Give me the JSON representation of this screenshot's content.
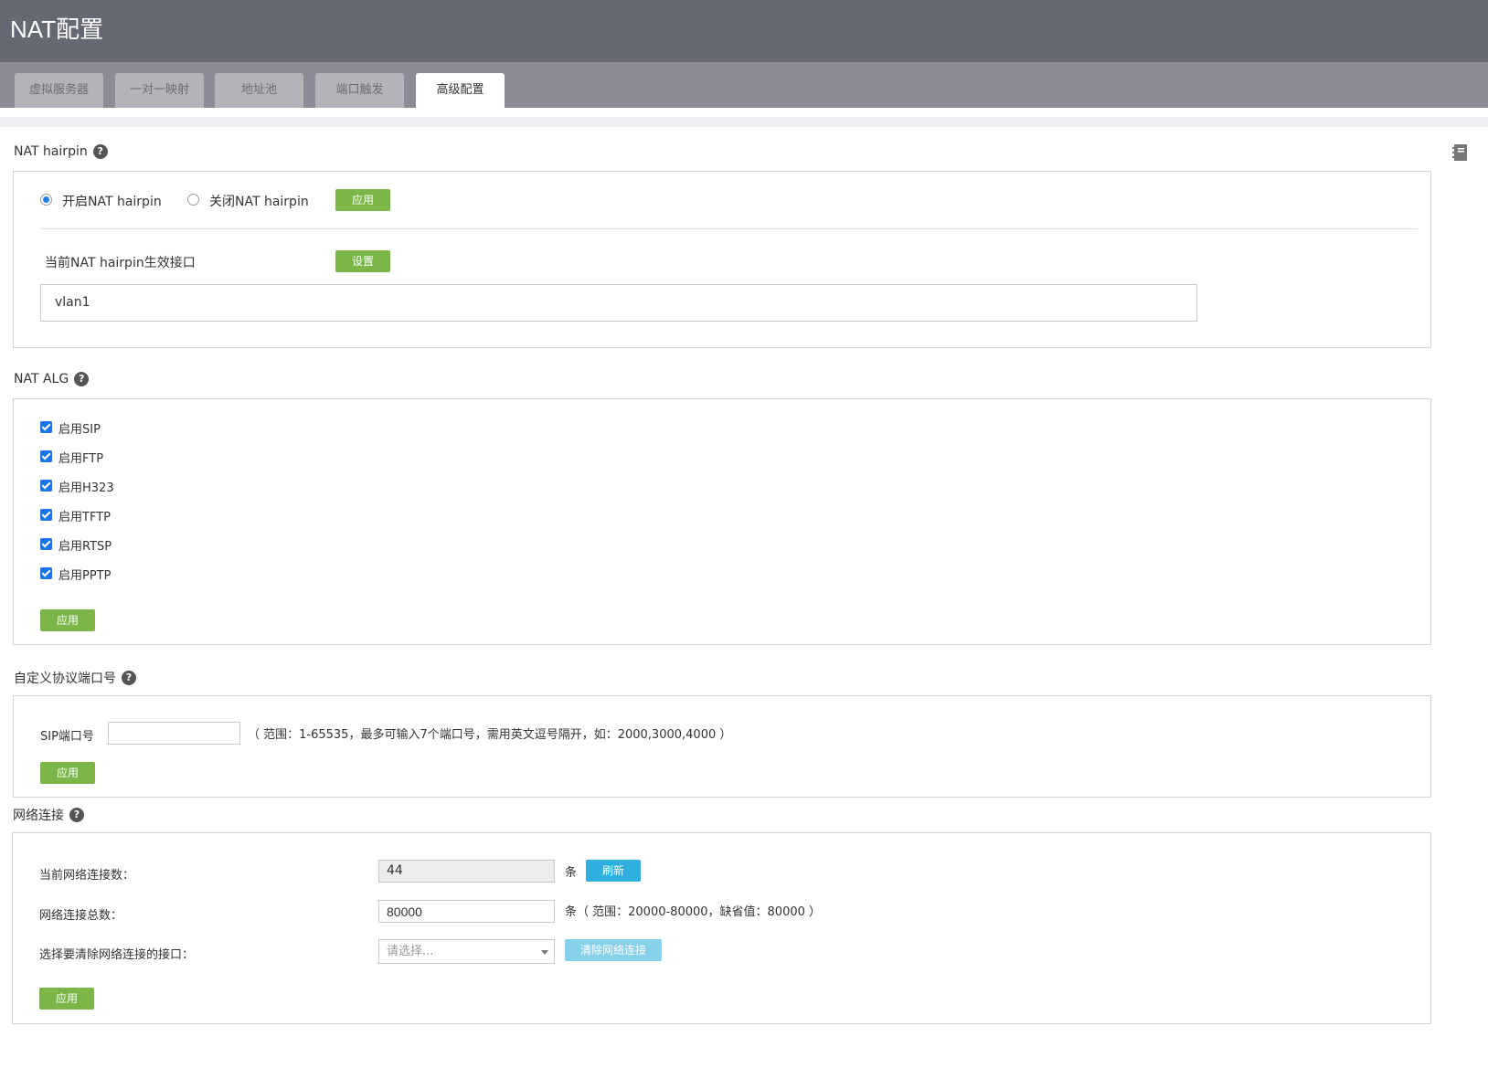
{
  "header": {
    "title": "NAT配置"
  },
  "tabs": [
    {
      "label": "虚拟服务器"
    },
    {
      "label": "一对一映射"
    },
    {
      "label": "地址池"
    },
    {
      "label": "端口触发"
    },
    {
      "label": "高级配置",
      "active": true
    }
  ],
  "hairpin": {
    "title": "NAT hairpin",
    "radio_on_label": "开启NAT hairpin",
    "radio_off_label": "关闭NAT hairpin",
    "selected": "on",
    "apply_label": "应用",
    "iface_label": "当前NAT hairpin生效接口",
    "set_label": "设置",
    "iface_value": "vlan1"
  },
  "alg": {
    "title": "NAT ALG",
    "items": [
      {
        "label": "启用SIP",
        "checked": true
      },
      {
        "label": "启用FTP",
        "checked": true
      },
      {
        "label": "启用H323",
        "checked": true
      },
      {
        "label": "启用TFTP",
        "checked": true
      },
      {
        "label": "启用RTSP",
        "checked": true
      },
      {
        "label": "启用PPTP",
        "checked": true
      }
    ],
    "apply_label": "应用"
  },
  "custom_port": {
    "title": "自定义协议端口号",
    "sip_label": "SIP端口号",
    "sip_value": "",
    "hint": "（ 范围：1-65535，最多可输入7个端口号，需用英文逗号隔开，如：2000,3000,4000 ）",
    "apply_label": "应用"
  },
  "net_conn": {
    "title": "网络连接",
    "current_label": "当前网络连接数：",
    "current_value": "44",
    "unit": "条",
    "refresh_label": "刷新",
    "total_label": "网络连接总数：",
    "total_value": "80000",
    "total_hint": "条（ 范围：20000-80000，缺省值：80000 ）",
    "clear_iface_label": "选择要清除网络连接的接口：",
    "select_placeholder": "请选择...",
    "clear_label": "清除网络连接",
    "apply_label": "应用"
  },
  "icons": {
    "help": "question-icon",
    "manual": "notebook-icon"
  },
  "colors": {
    "header": "#666873",
    "tabbar": "#8d8b95",
    "green": "#7ab648",
    "blue": "#30aee0"
  }
}
